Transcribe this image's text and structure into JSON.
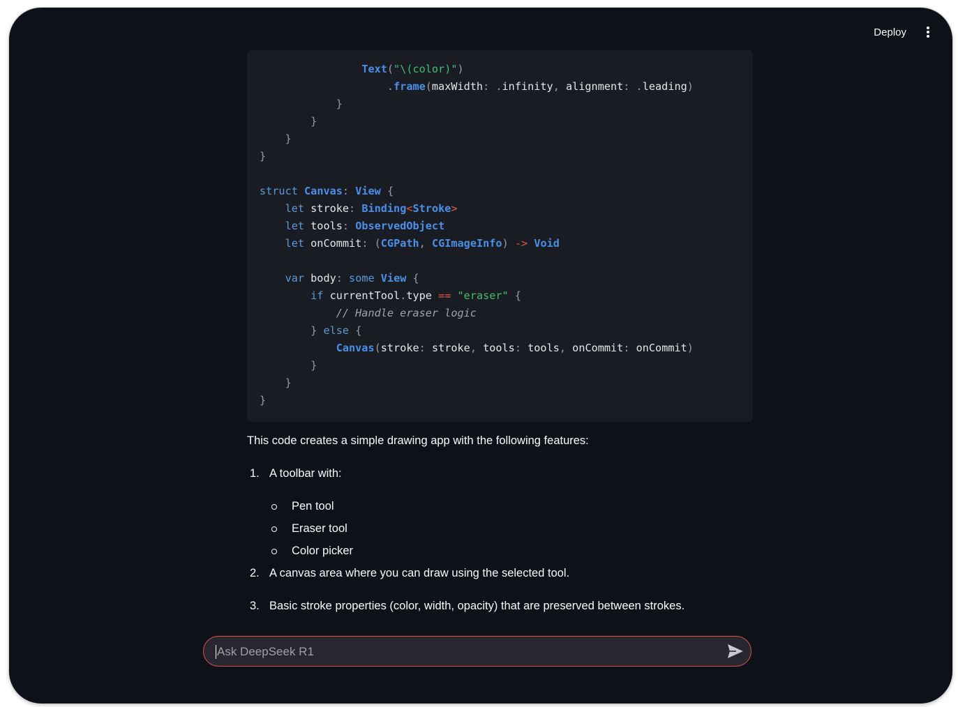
{
  "header": {
    "deploy_label": "Deploy",
    "menu_icon": "vertical-ellipsis-icon"
  },
  "code_block": {
    "language": "swift",
    "lines": [
      "                Text(\"\\(color)\")",
      "                    .frame(maxWidth: .infinity, alignment: .leading)",
      "            }",
      "        }",
      "    }",
      "}",
      "",
      "struct Canvas: View {",
      "    let stroke: Binding<Stroke>",
      "    let tools: ObservedObject",
      "    let onCommit: (CGPath, CGImageInfo) -> Void",
      "",
      "    var body: some View {",
      "        if currentTool.type == \"eraser\" {",
      "            // Handle eraser logic",
      "        } else {",
      "            Canvas(stroke: stroke, tools: tools, onCommit: onCommit)",
      "        }",
      "    }",
      "}"
    ]
  },
  "answer": {
    "intro": "This code creates a simple drawing app with the following features:",
    "items": [
      {
        "num": "1.",
        "text": "A toolbar with:",
        "sub": [
          "Pen tool",
          "Eraser tool",
          "Color picker"
        ]
      },
      {
        "num": "2.",
        "text": "A canvas area where you can draw using the selected tool."
      },
      {
        "num": "3.",
        "text": "Basic stroke properties (color, width, opacity) that are preserved between strokes."
      }
    ]
  },
  "chat_input": {
    "placeholder": "Ask DeepSeek R1",
    "value": "",
    "send_icon": "send-arrow-icon"
  },
  "colors": {
    "background": "#0e1117",
    "code_bg": "#1a1c24",
    "input_border": "#e0544e",
    "keyword": "#5c9ad5",
    "type": "#4a8fe8",
    "string": "#3fbf6f"
  }
}
